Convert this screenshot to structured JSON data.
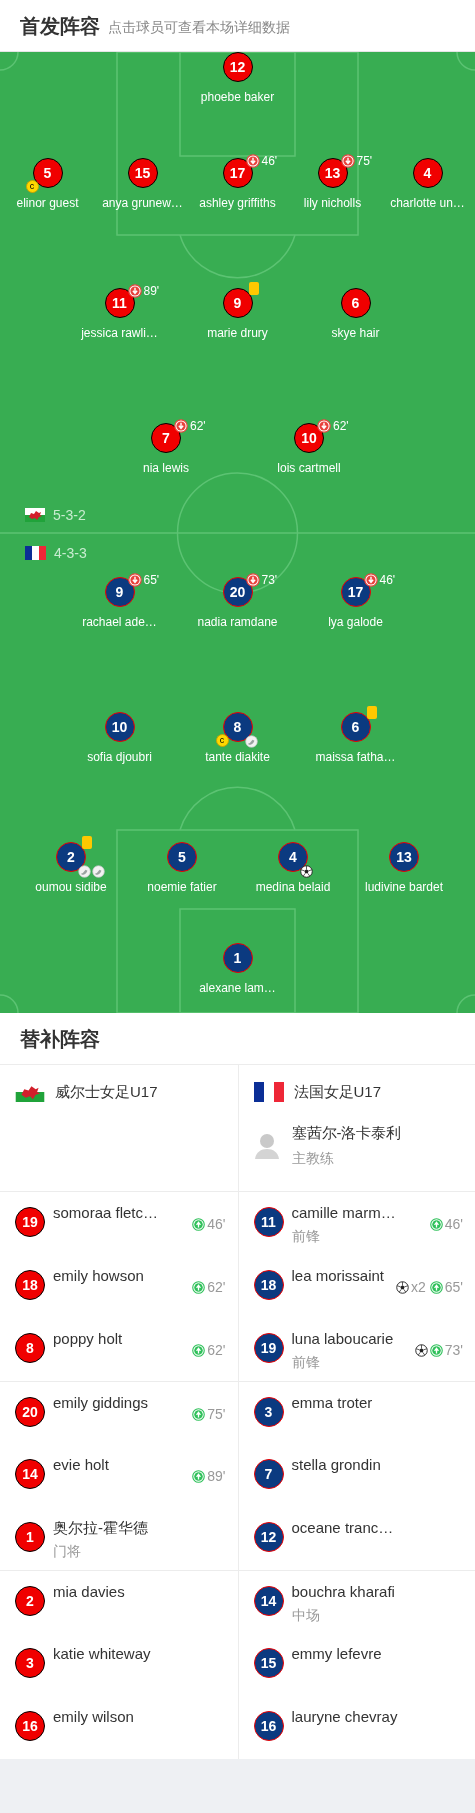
{
  "starting_lineup": {
    "title": "首发阵容",
    "hint": "点击球员可查看本场详细数据",
    "teams": [
      {
        "formation": "5-3-2",
        "lines": [
          {
            "players": [
              {
                "number": "12",
                "name": "phoebe baker",
                "yellow_card": false
              }
            ]
          },
          {
            "players": [
              {
                "number": "5",
                "name": "elinor guest",
                "captain_badge": "c",
                "yellow_card": false
              },
              {
                "number": "15",
                "name": "anya grunew…",
                "yellow_card": false
              },
              {
                "number": "17",
                "name": "ashley griffiths",
                "sub_out": "46'",
                "yellow_card": false
              },
              {
                "number": "13",
                "name": "lily nicholls",
                "sub_out": "75'",
                "yellow_card": false
              },
              {
                "number": "4",
                "name": "charlotte un…",
                "yellow_card": false
              }
            ]
          },
          {
            "players": [
              {
                "number": "11",
                "name": "jessica rawli…",
                "sub_out": "89'",
                "yellow_card": false
              },
              {
                "number": "9",
                "name": "marie drury",
                "yellow_card": true
              },
              {
                "number": "6",
                "name": "skye hair",
                "yellow_card": false
              }
            ]
          },
          {
            "players": [
              {
                "number": "7",
                "name": "nia lewis",
                "sub_out": "62'",
                "yellow_card": false
              },
              {
                "number": "10",
                "name": "lois cartmell",
                "sub_out": "62'",
                "yellow_card": false
              }
            ]
          }
        ]
      },
      {
        "formation": "4-3-3",
        "lines": [
          {
            "players": [
              {
                "number": "9",
                "name": "rachael ade…",
                "sub_out": "65'",
                "yellow_card": false
              },
              {
                "number": "20",
                "name": "nadia ramdane",
                "sub_out": "73'",
                "yellow_card": false
              },
              {
                "number": "17",
                "name": "lya galode",
                "sub_out": "46'",
                "yellow_card": false
              }
            ]
          },
          {
            "players": [
              {
                "number": "10",
                "name": "sofia djoubri",
                "yellow_card": false
              },
              {
                "number": "8",
                "name": "tante diakite",
                "captain_badge": "c",
                "yellow_card": false,
                "events": [
                  {
                    "kind": "assist"
                  }
                ]
              },
              {
                "number": "6",
                "name": "maissa fatha…",
                "yellow_card": true
              }
            ]
          },
          {
            "players": [
              {
                "number": "2",
                "name": "oumou sidibe",
                "yellow_card": true,
                "events": [
                  {
                    "kind": "assist"
                  },
                  {
                    "kind": "assist"
                  }
                ]
              },
              {
                "number": "5",
                "name": "noemie fatier",
                "yellow_card": false
              },
              {
                "number": "4",
                "name": "medina belaid",
                "yellow_card": false,
                "events": [
                  {
                    "kind": "goal"
                  }
                ]
              },
              {
                "number": "13",
                "name": "ludivine bardet",
                "yellow_card": false
              }
            ]
          },
          {
            "players": [
              {
                "number": "1",
                "name": "alexane lam…",
                "yellow_card": false
              }
            ]
          }
        ]
      }
    ]
  },
  "substitutes": {
    "title": "替补阵容",
    "teams": [
      {
        "team": "威尔士女足U17",
        "players": [
          {
            "number": "19",
            "name": "somoraa fletc…",
            "sub_on": "46'",
            "scored": false
          },
          {
            "number": "18",
            "name": "emily howson",
            "sub_on": "62'",
            "scored": false
          },
          {
            "number": "8",
            "name": "poppy holt",
            "sub_on": "62'",
            "scored": false
          },
          {
            "number": "20",
            "name": "emily giddings",
            "sub_on": "75'",
            "scored": false
          },
          {
            "number": "14",
            "name": "evie holt",
            "sub_on": "89'",
            "scored": false
          },
          {
            "number": "1",
            "name": "奥尔拉-霍华德",
            "position": "门将",
            "scored": false
          },
          {
            "number": "2",
            "name": "mia davies",
            "scored": false
          },
          {
            "number": "3",
            "name": "katie whiteway",
            "scored": false
          },
          {
            "number": "16",
            "name": "emily wilson",
            "scored": false
          }
        ]
      },
      {
        "team": "法国女足U17",
        "coach": {
          "name": "塞茜尔-洛卡泰利",
          "role": "主教练"
        },
        "players": [
          {
            "number": "11",
            "name": "camille marm…",
            "position": "前锋",
            "sub_on": "46'",
            "scored": false
          },
          {
            "number": "18",
            "name": "lea morissaint",
            "sub_on": "65'",
            "scored": true,
            "goal_count": "x2"
          },
          {
            "number": "19",
            "name": "luna laboucarie",
            "position": "前锋",
            "sub_on": "73'",
            "scored": true
          },
          {
            "number": "3",
            "name": "emma troter",
            "scored": false
          },
          {
            "number": "7",
            "name": "stella grondin",
            "scored": false
          },
          {
            "number": "12",
            "name": "oceane tranc…",
            "scored": false
          },
          {
            "number": "14",
            "name": "bouchra kharafi",
            "position": "中场",
            "scored": false
          },
          {
            "number": "15",
            "name": "emmy lefevre",
            "scored": false
          },
          {
            "number": "16",
            "name": "lauryne chevray",
            "scored": false
          }
        ]
      }
    ]
  }
}
